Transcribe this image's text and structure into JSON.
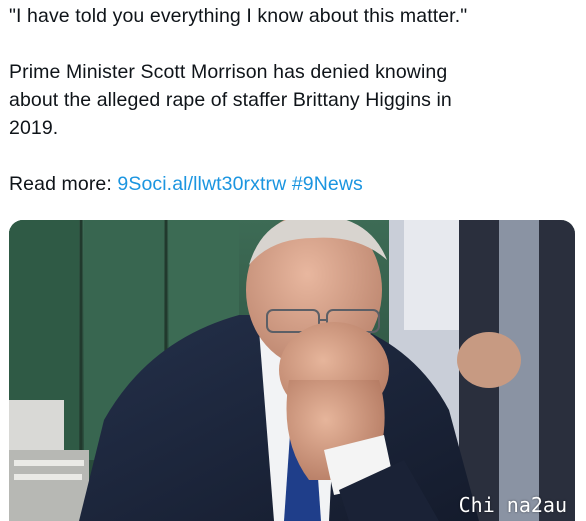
{
  "tweet": {
    "quote": "\"I have told you everything I know about this matter.\"",
    "body_line1": "Prime Minister Scott Morrison has denied knowing",
    "body_line2": "about the alleged rape of staffer Brittany Higgins in",
    "body_line3": "2019.",
    "read_more_prefix": "Read more: ",
    "link_text": "9Soci.al/llwt30rxtrw",
    "hashtag": "#9News",
    "link_color": "#1b95e0"
  },
  "media": {
    "watermark": "Chi na2au"
  }
}
